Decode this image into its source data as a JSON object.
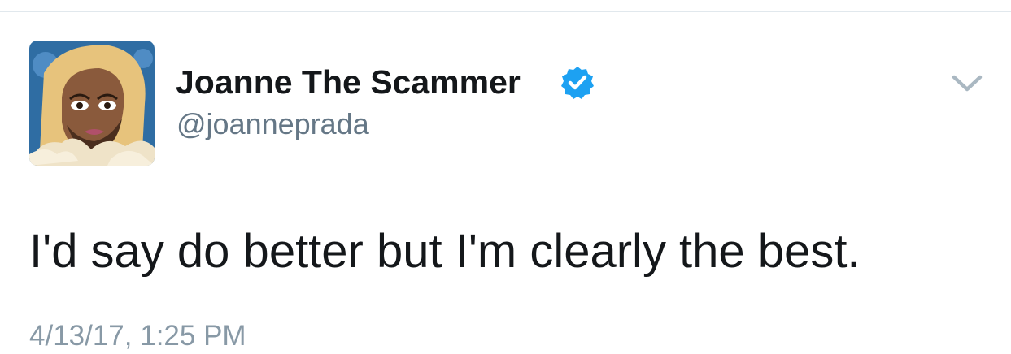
{
  "tweet": {
    "author": {
      "display_name": "Joanne The Scammer",
      "handle": "@joanneprada",
      "verified": true,
      "verified_icon": "verified-badge-icon",
      "avatar": "cartoon-portrait-avatar"
    },
    "menu_icon": "chevron-down-icon",
    "text": "I'd say do better but I'm clearly the best.",
    "timestamp": "4/13/17, 1:25 PM"
  },
  "colors": {
    "name": "#14171a",
    "handle": "#657786",
    "verified": "#1da1f2",
    "chevron": "#aab8c2",
    "timestamp": "#8899a6",
    "divider": "#e1e8ed"
  }
}
